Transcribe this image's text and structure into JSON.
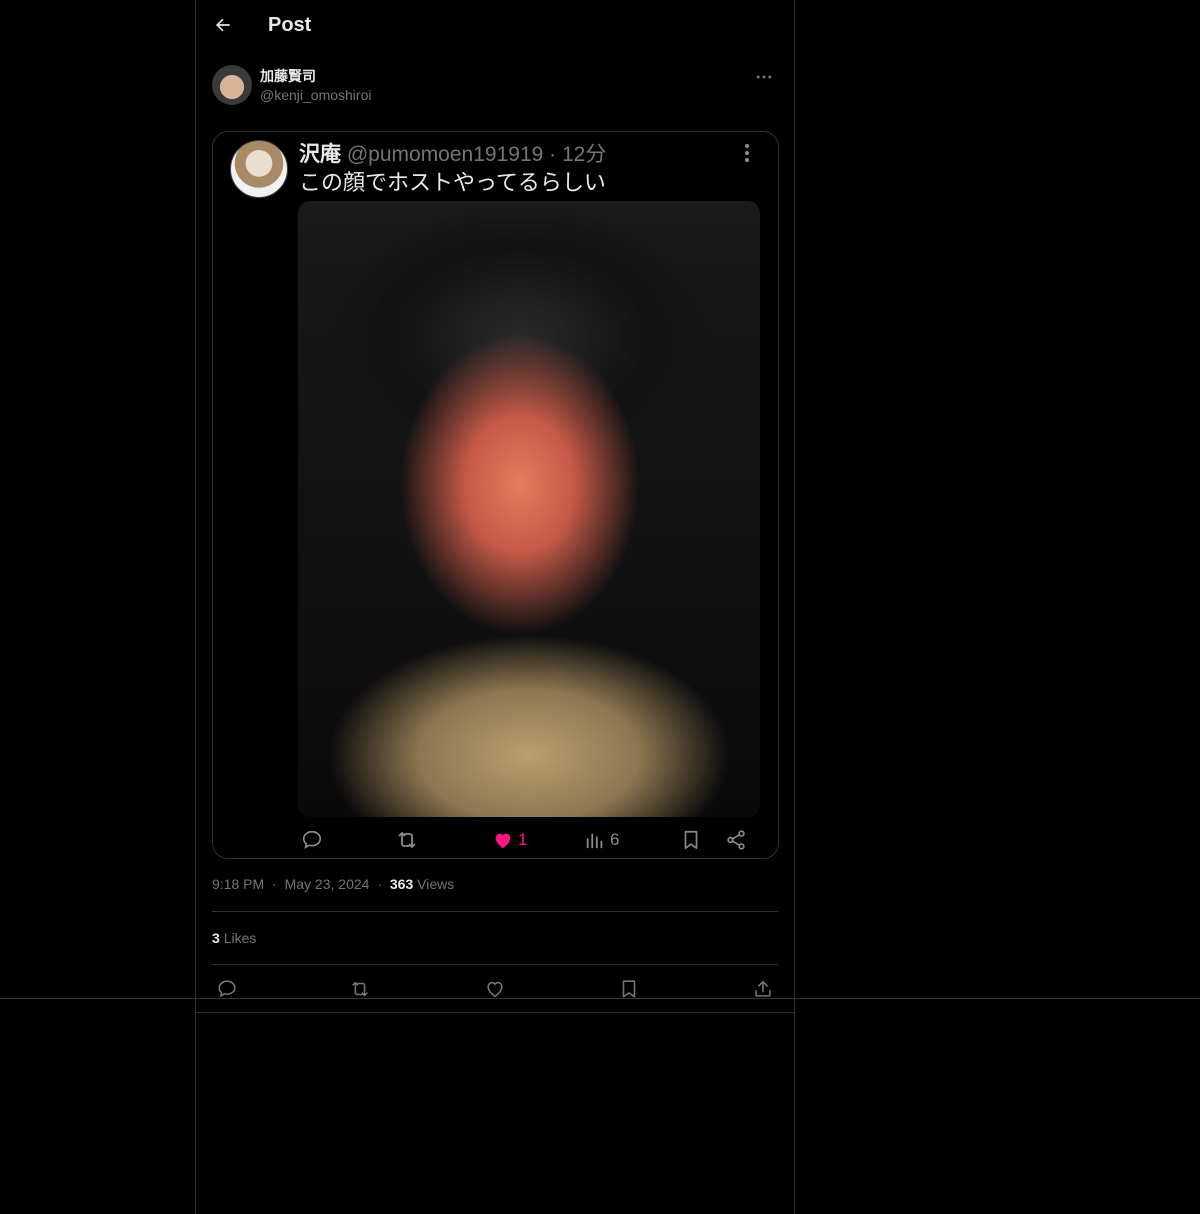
{
  "header": {
    "title": "Post"
  },
  "author": {
    "name": "加藤賢司",
    "handle": "@kenji_omoshiroi"
  },
  "quoted": {
    "name": "沢庵",
    "handle": "@pumomoen191919",
    "separator": "·",
    "time": "12分",
    "text": "この顔でホストやってるらしい",
    "likes": "1",
    "views": "6"
  },
  "meta": {
    "time": "9:18 PM",
    "date": "May 23, 2024",
    "dot": "·",
    "views_count": "363",
    "views_label": "Views"
  },
  "likes": {
    "count": "3",
    "label": "Likes"
  },
  "colors": {
    "background": "#000000",
    "border": "#2f3336",
    "muted": "#71767b",
    "like_pink": "#f91880"
  }
}
